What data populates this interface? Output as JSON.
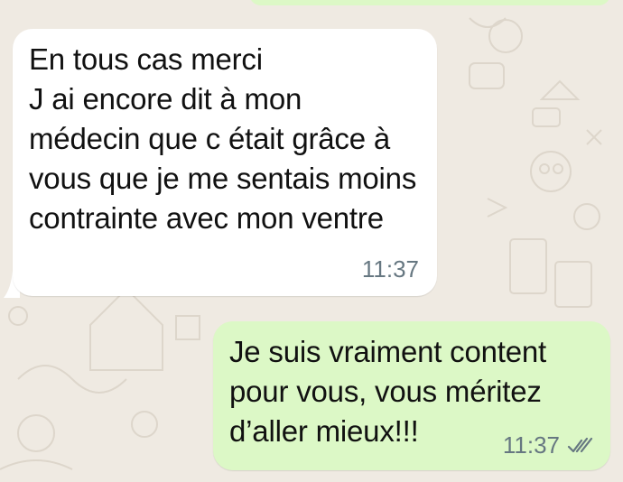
{
  "colors": {
    "wallpaper": "#efeae2",
    "incoming_bubble": "#ffffff",
    "outgoing_bubble": "#dcf8c6",
    "timestamp": "#667781"
  },
  "messages": [
    {
      "direction": "incoming",
      "text": "En tous cas merci\nJ ai encore dit à mon médecin que c était grâce à vous que je me sentais moins contrainte avec mon ventre",
      "time": "11:37"
    },
    {
      "direction": "outgoing",
      "text": "Je suis vraiment content pour vous, vous méritez d’aller mieux!!!",
      "time": "11:37",
      "status_icon": "double-check-icon"
    }
  ]
}
